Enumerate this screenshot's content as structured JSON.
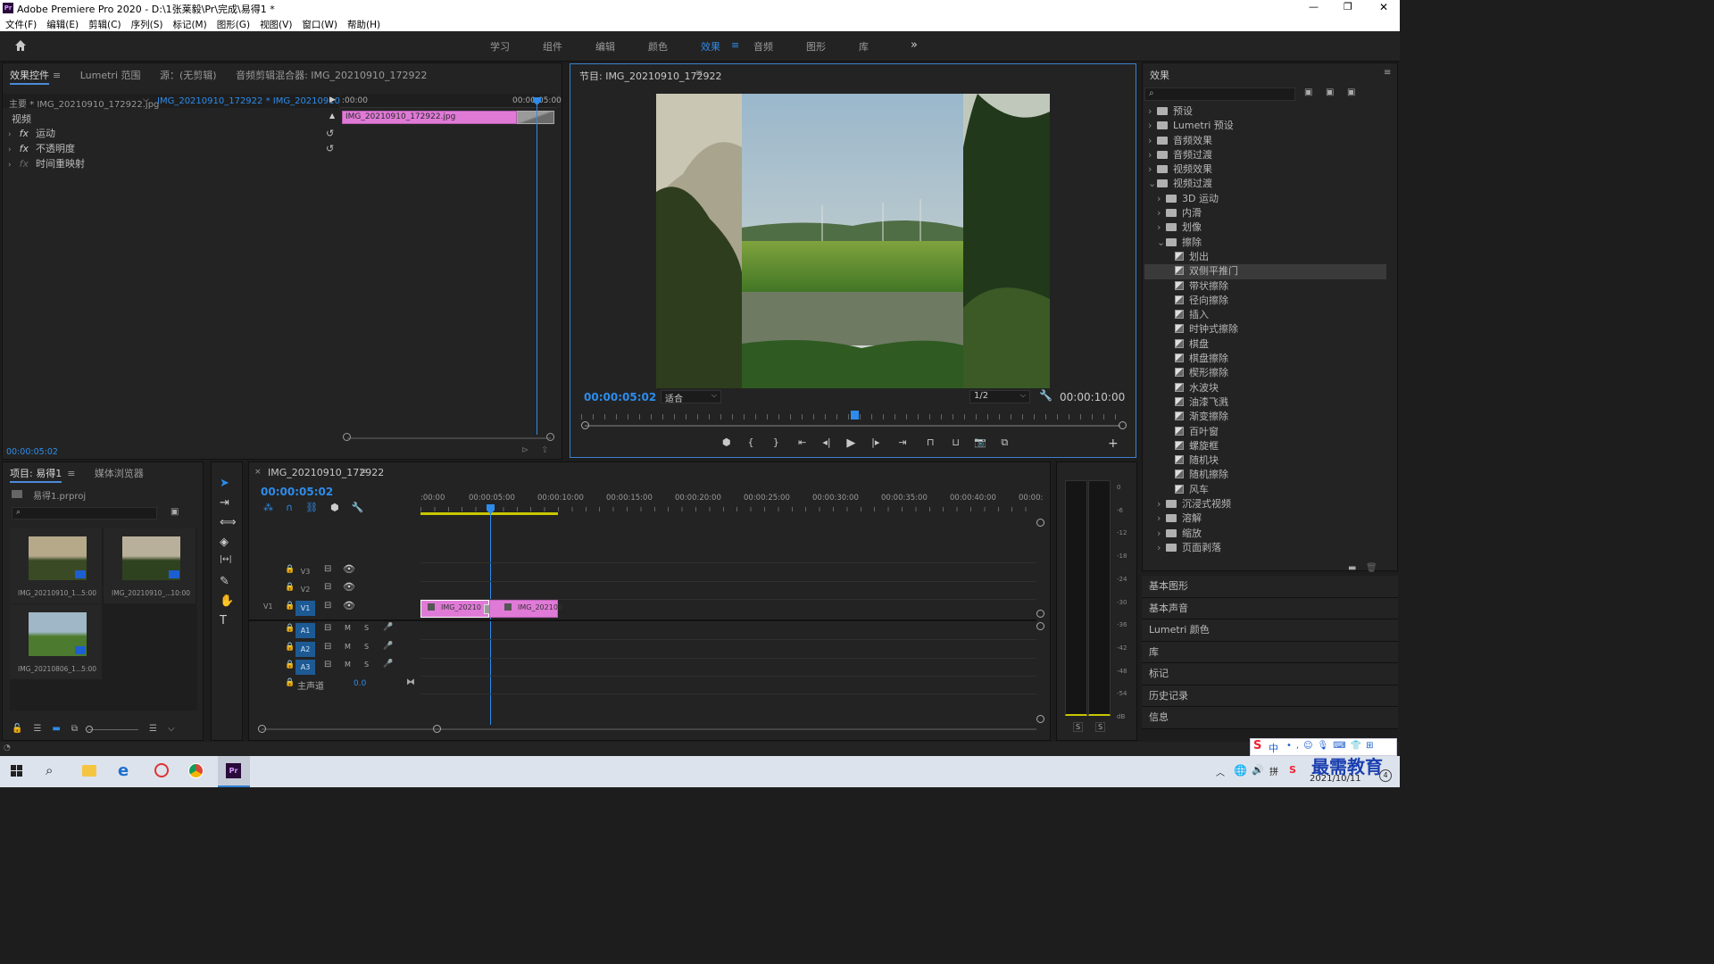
{
  "window": {
    "title": "Adobe Premiere Pro 2020 - D:\\1张莱毅\\Pr\\完成\\易得1 *",
    "controls": [
      "—",
      "❐",
      "✕"
    ]
  },
  "menu": [
    "文件(F)",
    "编辑(E)",
    "剪辑(C)",
    "序列(S)",
    "标记(M)",
    "图形(G)",
    "视图(V)",
    "窗口(W)",
    "帮助(H)"
  ],
  "workspaces": [
    "学习",
    "组件",
    "编辑",
    "颜色",
    "效果",
    "音频",
    "图形",
    "库"
  ],
  "active_workspace": "效果",
  "effect_controls": {
    "tabs": [
      "效果控件",
      "Lumetri 范围",
      "源：(无剪辑)",
      "音频剪辑混合器: IMG_20210910_172922"
    ],
    "master": "主要 * IMG_20210910_172922.jpg",
    "sequence_clip": "IMG_20210910_172922 * IMG_20210910_...",
    "section": "视频",
    "items": [
      {
        "label": "运动",
        "fx": "fx"
      },
      {
        "label": "不透明度",
        "fx": "fx"
      },
      {
        "label": "时间重映射",
        "fx": "fx"
      }
    ],
    "ruler": [
      ":00:00",
      "00:00:05:00"
    ],
    "clip_name": "IMG_20210910_172922.jpg",
    "timecode": "00:00:05:02"
  },
  "program": {
    "title": "节目: IMG_20210910_172922",
    "timecode": "00:00:05:02",
    "fit": "适合",
    "resolution": "1/2",
    "duration": "00:00:10:00"
  },
  "effects_panel": {
    "title": "效果",
    "search_placeholder": "",
    "tree": [
      {
        "label": "预设",
        "type": "folder",
        "level": 0,
        "open": false
      },
      {
        "label": "Lumetri 预设",
        "type": "folder",
        "level": 0,
        "open": false
      },
      {
        "label": "音频效果",
        "type": "folder",
        "level": 0,
        "open": false
      },
      {
        "label": "音频过渡",
        "type": "folder",
        "level": 0,
        "open": false
      },
      {
        "label": "视频效果",
        "type": "folder",
        "level": 0,
        "open": false
      },
      {
        "label": "视频过渡",
        "type": "folder",
        "level": 0,
        "open": true
      },
      {
        "label": "3D 运动",
        "type": "folder",
        "level": 1,
        "open": false
      },
      {
        "label": "内滑",
        "type": "folder",
        "level": 1,
        "open": false
      },
      {
        "label": "划像",
        "type": "folder",
        "level": 1,
        "open": false
      },
      {
        "label": "擦除",
        "type": "folder",
        "level": 1,
        "open": true
      },
      {
        "label": "划出",
        "type": "fx",
        "level": 2
      },
      {
        "label": "双侧平推门",
        "type": "fx",
        "level": 2,
        "selected": true
      },
      {
        "label": "带状擦除",
        "type": "fx",
        "level": 2
      },
      {
        "label": "径向擦除",
        "type": "fx",
        "level": 2
      },
      {
        "label": "插入",
        "type": "fx",
        "level": 2
      },
      {
        "label": "时钟式擦除",
        "type": "fx",
        "level": 2
      },
      {
        "label": "棋盘",
        "type": "fx",
        "level": 2
      },
      {
        "label": "棋盘擦除",
        "type": "fx",
        "level": 2
      },
      {
        "label": "楔形擦除",
        "type": "fx",
        "level": 2
      },
      {
        "label": "水波块",
        "type": "fx",
        "level": 2
      },
      {
        "label": "油漆飞溅",
        "type": "fx",
        "level": 2
      },
      {
        "label": "渐变擦除",
        "type": "fx",
        "level": 2
      },
      {
        "label": "百叶窗",
        "type": "fx",
        "level": 2
      },
      {
        "label": "螺旋框",
        "type": "fx",
        "level": 2
      },
      {
        "label": "随机块",
        "type": "fx",
        "level": 2
      },
      {
        "label": "随机擦除",
        "type": "fx",
        "level": 2
      },
      {
        "label": "风车",
        "type": "fx",
        "level": 2
      },
      {
        "label": "沉浸式视频",
        "type": "folder",
        "level": 1,
        "open": false
      },
      {
        "label": "溶解",
        "type": "folder",
        "level": 1,
        "open": false
      },
      {
        "label": "缩放",
        "type": "folder",
        "level": 1,
        "open": false
      },
      {
        "label": "页面剥落",
        "type": "folder",
        "level": 1,
        "open": false
      }
    ],
    "collapsed_panels": [
      "基本图形",
      "基本声音",
      "Lumetri 颜色",
      "库",
      "标记",
      "历史记录",
      "信息"
    ]
  },
  "project": {
    "tabs": [
      "项目: 易得1",
      "媒体浏览器"
    ],
    "file": "易得1.prproj",
    "search_placeholder": "",
    "items": [
      {
        "name": "IMG_20210910_1...",
        "dur": "5:00"
      },
      {
        "name": "IMG_20210910_...",
        "dur": "10:00"
      },
      {
        "name": "IMG_20210806_1...",
        "dur": "5:00"
      }
    ]
  },
  "timeline": {
    "tab": "IMG_20210910_172922",
    "timecode": "00:00:05:02",
    "ruler": [
      ":00:00",
      "00:00:05:00",
      "00:00:10:00",
      "00:00:15:00",
      "00:00:20:00",
      "00:00:25:00",
      "00:00:30:00",
      "00:00:35:00",
      "00:00:40:00",
      "00:00:"
    ],
    "video_tracks": [
      "V3",
      "V2",
      "V1"
    ],
    "audio_tracks": [
      "A1",
      "A2",
      "A3"
    ],
    "source_patch": "V1",
    "mix_label": "主声道",
    "mix_value": "0.0",
    "clips": [
      "IMG_20210",
      "IMG_202108"
    ],
    "ms": [
      "M",
      "S"
    ]
  },
  "meter": {
    "scale": [
      "0",
      "-6",
      "-12",
      "-18",
      "-24",
      "-30",
      "-36",
      "-42",
      "-48",
      "-54",
      "dB"
    ],
    "solo": [
      "S",
      "S"
    ]
  },
  "taskbar": {
    "date": "2021/10/11",
    "watermark": "最需教育",
    "ime": "中"
  }
}
